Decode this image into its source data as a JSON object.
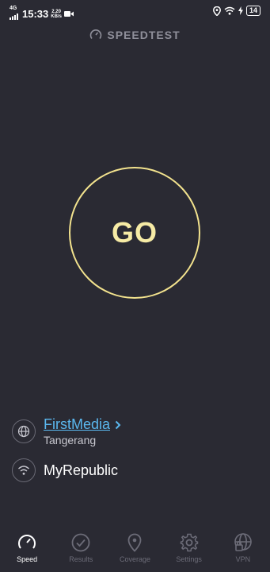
{
  "status_bar": {
    "network": "4G",
    "time": "15:33",
    "speed_value": "2.20",
    "speed_unit": "KB/s",
    "battery": "14"
  },
  "header": {
    "title": "SPEEDTEST"
  },
  "go_button": {
    "label": "GO"
  },
  "provider": {
    "name": "FirstMedia",
    "location": "Tangerang"
  },
  "wifi": {
    "name": "MyRepublic"
  },
  "tabs": [
    {
      "label": "Speed",
      "icon": "speedometer-icon",
      "active": true
    },
    {
      "label": "Results",
      "icon": "check-circle-icon",
      "active": false
    },
    {
      "label": "Coverage",
      "icon": "map-pin-icon",
      "active": false
    },
    {
      "label": "Settings",
      "icon": "gear-icon",
      "active": false
    },
    {
      "label": "VPN",
      "icon": "globe-lock-icon",
      "active": false
    }
  ],
  "colors": {
    "background": "#2a2a33",
    "go_ring": "#f3e38e",
    "go_text": "#f6eba5",
    "link": "#5bb8ef",
    "inactive_tab": "#6c6c78"
  }
}
